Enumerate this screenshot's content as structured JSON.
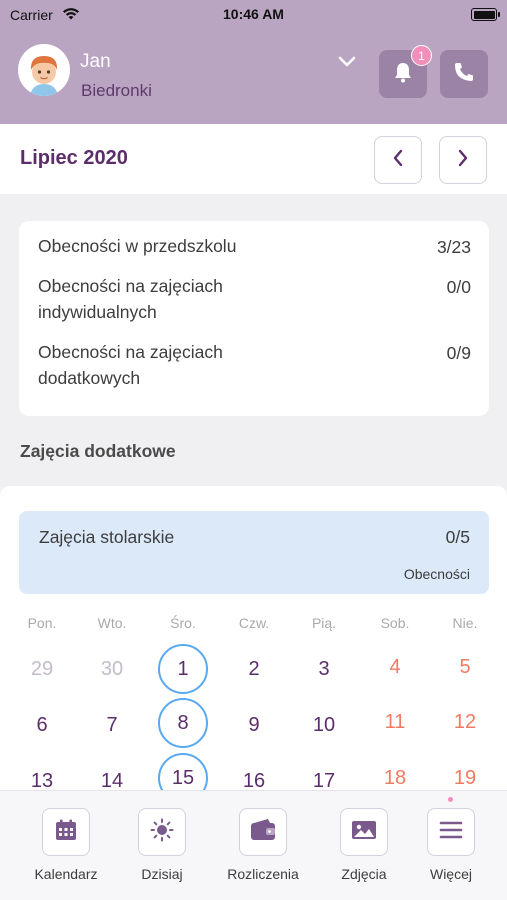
{
  "status_bar": {
    "carrier": "Carrier",
    "time": "10:46 AM"
  },
  "header": {
    "child_name": "Jan",
    "group_name": "Biedronki",
    "notification_count": "1",
    "colors": {
      "background": "#b9a4c1",
      "button": "#9b83a6",
      "badge": "#f08fba"
    }
  },
  "month_bar": {
    "title": "Lipiec 2020"
  },
  "stats": [
    {
      "label": "Obecności w przedszkolu",
      "value": "3/23"
    },
    {
      "label": "Obecności na zajęciach indywidualnych",
      "value": "0/0"
    },
    {
      "label": "Obecności na zajęciach dodatkowych",
      "value": "0/9"
    }
  ],
  "section_title": "Zajęcia dodatkowe",
  "activity": {
    "name": "Zajęcia stolarskie",
    "count": "0/5",
    "sublabel": "Obecności"
  },
  "calendar": {
    "weekdays": [
      "Pon.",
      "Wto.",
      "Śro.",
      "Czw.",
      "Pią.",
      "Sob.",
      "Nie."
    ],
    "rows": [
      [
        "29",
        "30",
        "1",
        "2",
        "3",
        "4",
        "5"
      ],
      [
        "6",
        "7",
        "8",
        "9",
        "10",
        "11",
        "12"
      ],
      [
        "13",
        "14",
        "15",
        "16",
        "17",
        "18",
        "19"
      ]
    ],
    "highlighted_days": [
      "1",
      "8",
      "15"
    ],
    "colors": {
      "day": "#5c2d6b",
      "weekend": "#f07a62",
      "muted": "#c4bccb",
      "highlight_ring": "#5aa9ef"
    }
  },
  "tabbar": {
    "items": [
      {
        "label": "Kalendarz",
        "icon": "calendar-icon"
      },
      {
        "label": "Dzisiaj",
        "icon": "sun-icon"
      },
      {
        "label": "Rozliczenia",
        "icon": "wallet-icon"
      },
      {
        "label": "Zdjęcia",
        "icon": "image-icon"
      },
      {
        "label": "Więcej",
        "icon": "menu-icon"
      }
    ]
  }
}
